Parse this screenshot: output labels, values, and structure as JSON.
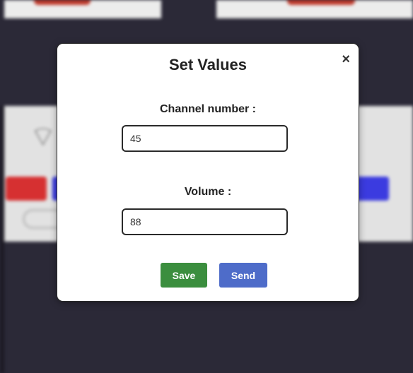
{
  "modal": {
    "title": "Set Values",
    "close_label": "×",
    "channel_label": "Channel number :",
    "channel_value": "45",
    "volume_label": "Volume :",
    "volume_value": "88",
    "save_label": "Save",
    "send_label": "Send"
  },
  "colors": {
    "save_button": "#3b8e3e",
    "send_button": "#4e6cc9",
    "overlay": "#2b2937"
  }
}
